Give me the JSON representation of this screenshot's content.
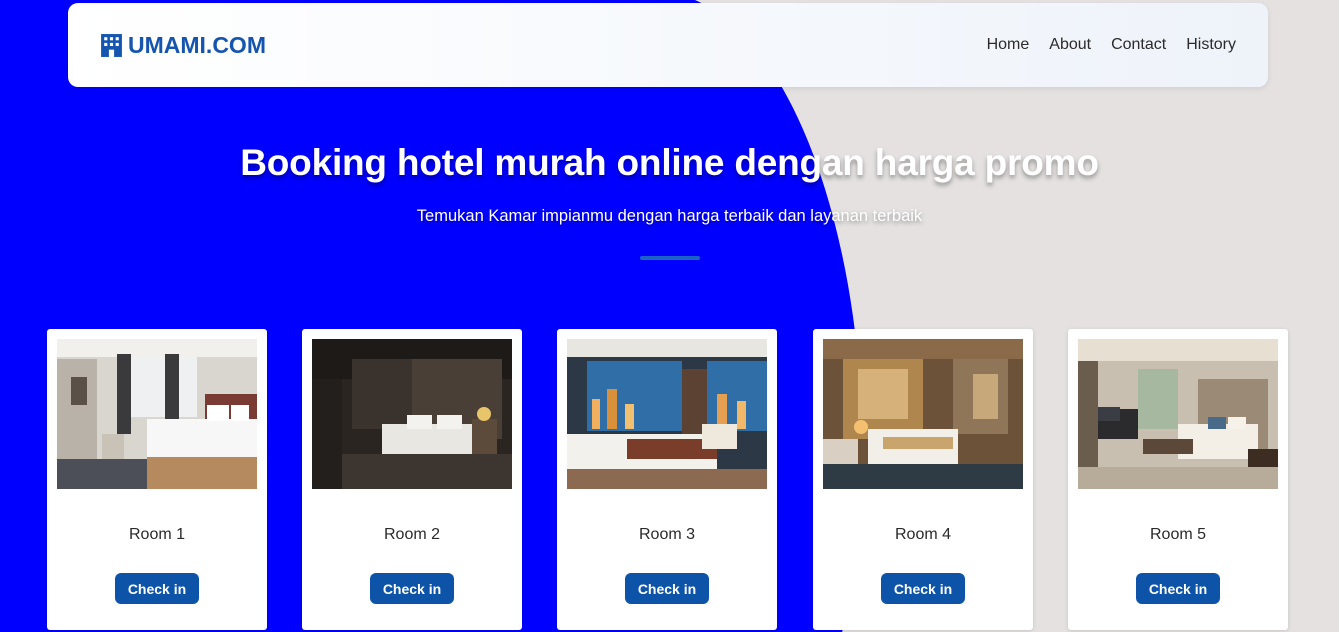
{
  "colors": {
    "accent_blue": "#0000ff",
    "brand_blue": "#1555b0",
    "button_blue": "#0d54a8",
    "page_bg": "#e4e1e0"
  },
  "brand": {
    "icon": "hotel-building-icon",
    "name": "UMAMI.COM"
  },
  "nav": {
    "items": [
      {
        "label": "Home"
      },
      {
        "label": "About"
      },
      {
        "label": "Contact"
      },
      {
        "label": "History"
      }
    ]
  },
  "hero": {
    "title": "Booking hotel murah online dengan harga promo",
    "subtitle": "Temukan Kamar impianmu dengan harga terbaik dan layanan terbaik"
  },
  "rooms": [
    {
      "name": "Room 1",
      "button": "Check in"
    },
    {
      "name": "Room 2",
      "button": "Check in"
    },
    {
      "name": "Room 3",
      "button": "Check in"
    },
    {
      "name": "Room 4",
      "button": "Check in"
    },
    {
      "name": "Room 5",
      "button": "Check in"
    }
  ]
}
